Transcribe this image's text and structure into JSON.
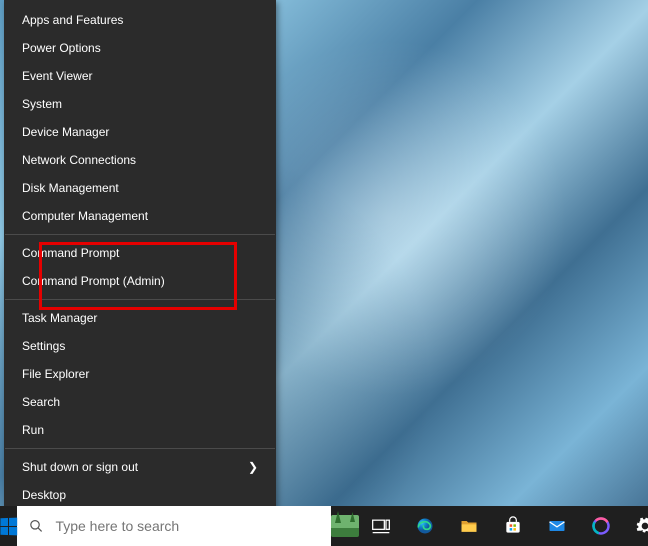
{
  "menu": {
    "group1": [
      "Apps and Features",
      "Power Options",
      "Event Viewer",
      "System",
      "Device Manager",
      "Network Connections",
      "Disk Management",
      "Computer Management"
    ],
    "group2": [
      "Command Prompt",
      "Command Prompt (Admin)"
    ],
    "group3": [
      "Task Manager",
      "Settings",
      "File Explorer",
      "Search",
      "Run"
    ],
    "group4": {
      "shutdown": "Shut down or sign out",
      "desktop": "Desktop"
    }
  },
  "taskbar": {
    "search_placeholder": "Type here to search"
  }
}
